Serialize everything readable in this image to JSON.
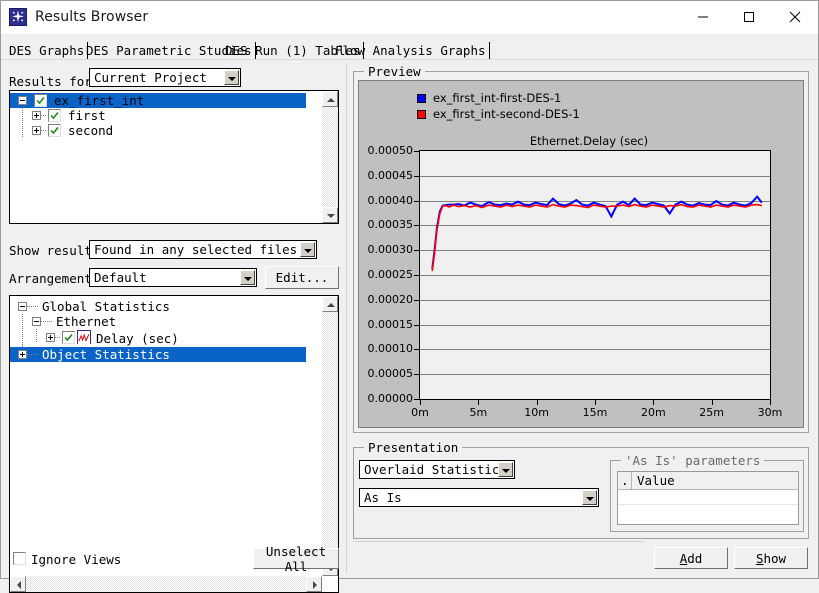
{
  "window": {
    "title": "Results Browser",
    "icon": "app-star-icon",
    "controls": {
      "minimize": "minimize-icon",
      "maximize": "maximize-icon",
      "close": "close-icon"
    }
  },
  "tabs": [
    {
      "label": "DES Graphs",
      "active": true
    },
    {
      "label": "DES Parametric Studies",
      "active": false
    },
    {
      "label": "DES Run (1) Tables",
      "active": false
    },
    {
      "label": "Flow Analysis Graphs",
      "active": false
    }
  ],
  "left_panel": {
    "results_for": {
      "label": "Results for:",
      "value": "Current Project"
    },
    "file_tree": [
      {
        "label": "ex_first_int",
        "depth": 0,
        "expander": "minus",
        "checked": true,
        "selected": true
      },
      {
        "label": "first",
        "depth": 1,
        "expander": "plus",
        "checked": true,
        "selected": false
      },
      {
        "label": "second",
        "depth": 1,
        "expander": "plus",
        "checked": true,
        "selected": false
      }
    ],
    "show_results": {
      "label": "Show results:",
      "value": "Found in any selected files"
    },
    "arrangement": {
      "label": "Arrangement:",
      "value": "Default"
    },
    "edit_button": "Edit...",
    "stat_tree": [
      {
        "label": "Global Statistics",
        "depth": 0,
        "expander": "minus",
        "checked": false,
        "icon": null,
        "selected": false
      },
      {
        "label": "Ethernet",
        "depth": 1,
        "expander": "minus",
        "checked": false,
        "icon": null,
        "selected": false
      },
      {
        "label": "Delay (sec)",
        "depth": 2,
        "expander": "plus",
        "checked": true,
        "icon": "chart-icon",
        "selected": false
      },
      {
        "label": "Object Statistics",
        "depth": 0,
        "expander": "plus",
        "checked": false,
        "icon": null,
        "selected": true
      }
    ],
    "ignore_views": {
      "label": "Ignore Views",
      "checked": false
    },
    "unselect_all_button": "Unselect All"
  },
  "preview": {
    "group_title": "Preview"
  },
  "chart_data": {
    "type": "line",
    "title": "Ethernet.Delay (sec)",
    "xlabel": "",
    "ylabel": "",
    "grid": true,
    "legend_position": "top-left",
    "xlim": [
      0,
      30
    ],
    "ylim": [
      0.0,
      0.0005
    ],
    "xtick_labels": [
      "0m",
      "5m",
      "10m",
      "15m",
      "20m",
      "25m",
      "30m"
    ],
    "xticks": [
      0,
      5,
      10,
      15,
      20,
      25,
      30
    ],
    "ytick_labels": [
      "0.00000",
      "0.00005",
      "0.00010",
      "0.00015",
      "0.00020",
      "0.00025",
      "0.00030",
      "0.00035",
      "0.00040",
      "0.00045",
      "0.00050"
    ],
    "yticks": [
      0.0,
      5e-05,
      0.0001,
      0.00015,
      0.0002,
      0.00025,
      0.0003,
      0.00035,
      0.0004,
      0.00045,
      0.0005
    ],
    "series": [
      {
        "name": "ex_first_int-first-DES-1",
        "color": "#0000ff",
        "x": [
          1.05,
          1.25,
          1.45,
          1.7,
          1.95,
          2.2,
          2.5,
          2.9,
          3.3,
          3.8,
          4.3,
          4.8,
          5.3,
          5.9,
          6.4,
          6.9,
          7.4,
          7.9,
          8.4,
          8.9,
          9.4,
          9.9,
          10.4,
          10.9,
          11.4,
          11.9,
          12.4,
          12.9,
          13.4,
          13.9,
          14.4,
          14.9,
          15.4,
          15.9,
          16.4,
          16.9,
          17.4,
          17.9,
          18.4,
          18.9,
          19.4,
          19.9,
          20.4,
          20.9,
          21.4,
          21.9,
          22.4,
          22.9,
          23.4,
          23.9,
          24.4,
          24.9,
          25.4,
          25.9,
          26.4,
          26.9,
          27.4,
          27.9,
          28.4,
          28.9,
          29.3
        ],
        "y": [
          0.000262,
          0.0003,
          0.000345,
          0.000378,
          0.00039,
          0.000391,
          0.000392,
          0.000392,
          0.000393,
          0.00039,
          0.000396,
          0.000392,
          0.000389,
          0.000397,
          0.000392,
          0.000391,
          0.000394,
          0.000392,
          0.000398,
          0.000392,
          0.000391,
          0.000396,
          0.000393,
          0.000391,
          0.000404,
          0.000393,
          0.00039,
          0.000394,
          0.000401,
          0.000392,
          0.00039,
          0.000396,
          0.000392,
          0.000389,
          0.000368,
          0.000392,
          0.000398,
          0.000391,
          0.000404,
          0.000392,
          0.000391,
          0.000396,
          0.000393,
          0.00039,
          0.000374,
          0.000392,
          0.000398,
          0.000392,
          0.00039,
          0.000395,
          0.000392,
          0.000391,
          0.000399,
          0.000392,
          0.00039,
          0.000396,
          0.000392,
          0.00039,
          0.000395,
          0.000408,
          0.000396
        ]
      },
      {
        "name": "ex_first_int-second-DES-1",
        "color": "#ff0000",
        "x": [
          1.05,
          1.25,
          1.45,
          1.7,
          1.95,
          2.2,
          2.5,
          2.9,
          3.3,
          3.8,
          4.3,
          4.8,
          5.3,
          5.9,
          6.4,
          6.9,
          7.4,
          7.9,
          8.4,
          8.9,
          9.4,
          9.9,
          10.4,
          10.9,
          11.4,
          11.9,
          12.4,
          12.9,
          13.4,
          13.9,
          14.4,
          14.9,
          15.4,
          15.9,
          16.4,
          16.9,
          17.4,
          17.9,
          18.4,
          18.9,
          19.4,
          19.9,
          20.4,
          20.9,
          21.4,
          21.9,
          22.4,
          22.9,
          23.4,
          23.9,
          24.4,
          24.9,
          25.4,
          25.9,
          26.4,
          26.9,
          27.4,
          27.9,
          28.4,
          28.9,
          29.3
        ],
        "y": [
          0.000258,
          0.000296,
          0.00034,
          0.000374,
          0.000389,
          0.00039,
          0.000387,
          0.000391,
          0.000388,
          0.00039,
          0.000387,
          0.00039,
          0.000386,
          0.000391,
          0.000389,
          0.000387,
          0.000391,
          0.000388,
          0.000391,
          0.000389,
          0.000387,
          0.000391,
          0.000389,
          0.000387,
          0.000392,
          0.000389,
          0.000387,
          0.000391,
          0.00039,
          0.000388,
          0.000386,
          0.000391,
          0.000389,
          0.000387,
          0.000389,
          0.000389,
          0.000391,
          0.000388,
          0.000392,
          0.000389,
          0.000387,
          0.000391,
          0.000389,
          0.000387,
          0.00039,
          0.000389,
          0.000392,
          0.000388,
          0.000387,
          0.000391,
          0.000389,
          0.000387,
          0.000391,
          0.000389,
          0.000387,
          0.000391,
          0.000389,
          0.000387,
          0.000391,
          0.000392,
          0.00039
        ]
      }
    ]
  },
  "presentation": {
    "group_title": "Presentation",
    "mode": "Overlaid Statistics",
    "style": "As Is",
    "params_group_title": "'As Is' parameters",
    "params_columns": [
      ".",
      "Value"
    ],
    "params_rows": [
      [
        "",
        ""
      ]
    ]
  },
  "footer": {
    "add_button": "Add",
    "add_mnemonic": "A",
    "show_button": "Show",
    "show_mnemonic": "S"
  },
  "colors": {
    "selection": "#0a64c8",
    "chart_bg": "#c0c0c0",
    "plot_bg": "#f0f0f0",
    "series_1": "#0000ff",
    "series_2": "#ff0000"
  }
}
